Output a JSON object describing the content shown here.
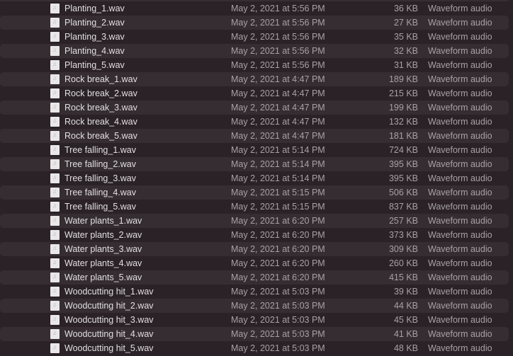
{
  "files": [
    {
      "name": "Planting_1.wav",
      "date": "May 2, 2021 at 5:56 PM",
      "size": "36 KB",
      "kind": "Waveform audio"
    },
    {
      "name": "Planting_2.wav",
      "date": "May 2, 2021 at 5:56 PM",
      "size": "27 KB",
      "kind": "Waveform audio"
    },
    {
      "name": "Planting_3.wav",
      "date": "May 2, 2021 at 5:56 PM",
      "size": "35 KB",
      "kind": "Waveform audio"
    },
    {
      "name": "Planting_4.wav",
      "date": "May 2, 2021 at 5:56 PM",
      "size": "32 KB",
      "kind": "Waveform audio"
    },
    {
      "name": "Planting_5.wav",
      "date": "May 2, 2021 at 5:56 PM",
      "size": "31 KB",
      "kind": "Waveform audio"
    },
    {
      "name": "Rock break_1.wav",
      "date": "May 2, 2021 at 4:47 PM",
      "size": "189 KB",
      "kind": "Waveform audio"
    },
    {
      "name": "Rock break_2.wav",
      "date": "May 2, 2021 at 4:47 PM",
      "size": "215 KB",
      "kind": "Waveform audio"
    },
    {
      "name": "Rock break_3.wav",
      "date": "May 2, 2021 at 4:47 PM",
      "size": "199 KB",
      "kind": "Waveform audio"
    },
    {
      "name": "Rock break_4.wav",
      "date": "May 2, 2021 at 4:47 PM",
      "size": "132 KB",
      "kind": "Waveform audio"
    },
    {
      "name": "Rock break_5.wav",
      "date": "May 2, 2021 at 4:47 PM",
      "size": "181 KB",
      "kind": "Waveform audio"
    },
    {
      "name": "Tree falling_1.wav",
      "date": "May 2, 2021 at 5:14 PM",
      "size": "724 KB",
      "kind": "Waveform audio"
    },
    {
      "name": "Tree falling_2.wav",
      "date": "May 2, 2021 at 5:14 PM",
      "size": "395 KB",
      "kind": "Waveform audio"
    },
    {
      "name": "Tree falling_3.wav",
      "date": "May 2, 2021 at 5:14 PM",
      "size": "395 KB",
      "kind": "Waveform audio"
    },
    {
      "name": "Tree falling_4.wav",
      "date": "May 2, 2021 at 5:15 PM",
      "size": "506 KB",
      "kind": "Waveform audio"
    },
    {
      "name": "Tree falling_5.wav",
      "date": "May 2, 2021 at 5:15 PM",
      "size": "837 KB",
      "kind": "Waveform audio"
    },
    {
      "name": "Water plants_1.wav",
      "date": "May 2, 2021 at 6:20 PM",
      "size": "257 KB",
      "kind": "Waveform audio"
    },
    {
      "name": "Water plants_2.wav",
      "date": "May 2, 2021 at 6:20 PM",
      "size": "373 KB",
      "kind": "Waveform audio"
    },
    {
      "name": "Water plants_3.wav",
      "date": "May 2, 2021 at 6:20 PM",
      "size": "309 KB",
      "kind": "Waveform audio"
    },
    {
      "name": "Water plants_4.wav",
      "date": "May 2, 2021 at 6:20 PM",
      "size": "260 KB",
      "kind": "Waveform audio"
    },
    {
      "name": "Water plants_5.wav",
      "date": "May 2, 2021 at 6:20 PM",
      "size": "415 KB",
      "kind": "Waveform audio"
    },
    {
      "name": "Woodcutting hit_1.wav",
      "date": "May 2, 2021 at 5:03 PM",
      "size": "39 KB",
      "kind": "Waveform audio"
    },
    {
      "name": "Woodcutting hit_2.wav",
      "date": "May 2, 2021 at 5:03 PM",
      "size": "44 KB",
      "kind": "Waveform audio"
    },
    {
      "name": "Woodcutting hit_3.wav",
      "date": "May 2, 2021 at 5:03 PM",
      "size": "45 KB",
      "kind": "Waveform audio"
    },
    {
      "name": "Woodcutting hit_4.wav",
      "date": "May 2, 2021 at 5:03 PM",
      "size": "41 KB",
      "kind": "Waveform audio"
    },
    {
      "name": "Woodcutting hit_5.wav",
      "date": "May 2, 2021 at 5:03 PM",
      "size": "48 KB",
      "kind": "Waveform audio"
    }
  ],
  "icon": "audio-file-icon"
}
